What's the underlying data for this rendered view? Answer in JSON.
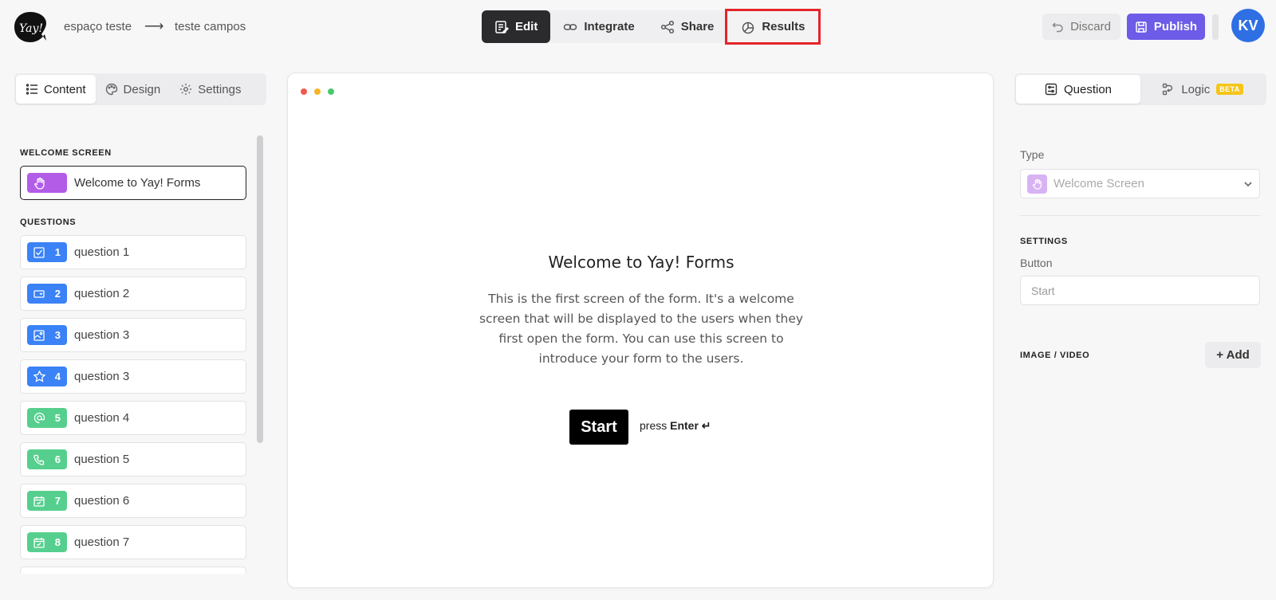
{
  "header": {
    "logo_text": "Yay!",
    "breadcrumb": [
      "espaço teste",
      "teste campos"
    ],
    "breadcrumb_sep": "⟶",
    "tabs": [
      {
        "label": "Edit",
        "icon": "edit-icon"
      },
      {
        "label": "Integrate",
        "icon": "link-icon"
      },
      {
        "label": "Share",
        "icon": "share-icon"
      },
      {
        "label": "Results",
        "icon": "chart-pie-icon"
      }
    ],
    "discard_label": "Discard",
    "publish_label": "Publish",
    "avatar_initials": "KV",
    "accent": "#6c5ce7",
    "highlight": "#e3252a"
  },
  "left": {
    "tabs": [
      "Content",
      "Design",
      "Settings"
    ],
    "welcome_label": "WELCOME SCREEN",
    "welcome_item": "Welcome to Yay! Forms",
    "questions_label": "QUESTIONS",
    "questions": [
      {
        "num": "1",
        "label": "question 1",
        "icon": "checkbox-icon",
        "color": "blue"
      },
      {
        "num": "2",
        "label": "question 2",
        "icon": "dropdown-icon",
        "color": "blue"
      },
      {
        "num": "3",
        "label": "question 3",
        "icon": "picture-choice-icon",
        "color": "blue"
      },
      {
        "num": "4",
        "label": "question 3",
        "icon": "star-icon",
        "color": "blue"
      },
      {
        "num": "5",
        "label": "question 4",
        "icon": "at-icon",
        "color": "green"
      },
      {
        "num": "6",
        "label": "question 5",
        "icon": "phone-icon",
        "color": "green"
      },
      {
        "num": "7",
        "label": "question 6",
        "icon": "calendar-icon",
        "color": "green"
      },
      {
        "num": "8",
        "label": "question 7",
        "icon": "calendar-icon",
        "color": "green"
      }
    ]
  },
  "preview": {
    "title": "Welcome to Yay! Forms",
    "description": "This is the first screen of the form. It's a welcome screen that will be displayed to the users when they first open the form. You can use this screen to introduce your form to the users.",
    "start_label": "Start",
    "press_label": "press",
    "enter_label": "Enter ↵"
  },
  "right": {
    "tabs": [
      "Question",
      "Logic"
    ],
    "beta_label": "BETA",
    "type_label": "Type",
    "type_value": "Welcome Screen",
    "settings_label": "SETTINGS",
    "button_label": "Button",
    "button_placeholder": "Start",
    "media_label": "IMAGE / VIDEO",
    "add_label": "+ Add"
  }
}
